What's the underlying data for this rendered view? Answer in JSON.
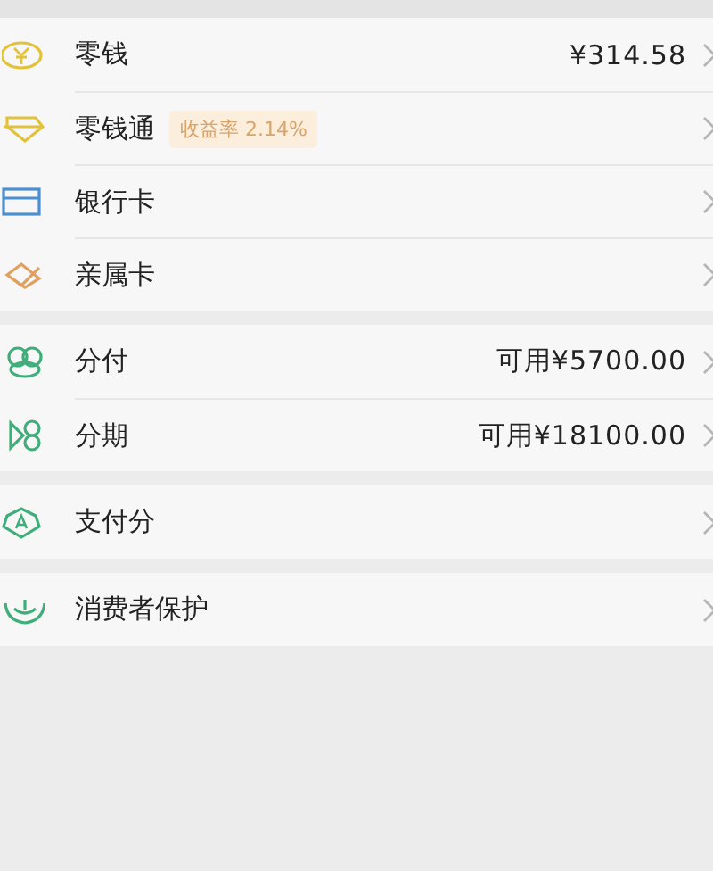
{
  "groups": [
    {
      "items": [
        {
          "label": "零钱",
          "value": "¥314.58"
        },
        {
          "label": "零钱通",
          "badge": "收益率 2.14%"
        },
        {
          "label": "银行卡"
        },
        {
          "label": "亲属卡"
        }
      ]
    },
    {
      "items": [
        {
          "label": "分付",
          "value": "可用¥5700.00"
        },
        {
          "label": "分期",
          "value": "可用¥18100.00"
        }
      ]
    },
    {
      "items": [
        {
          "label": "支付分"
        }
      ]
    },
    {
      "items": [
        {
          "label": "消费者保护"
        }
      ]
    }
  ]
}
